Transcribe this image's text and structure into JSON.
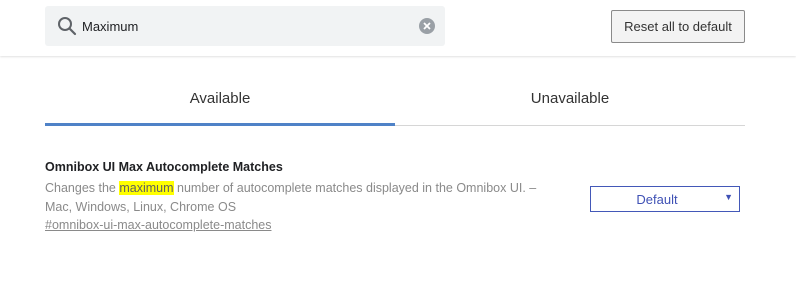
{
  "search": {
    "value": "Maximum",
    "search_icon": "search-icon",
    "clear_icon": "clear-circle-icon"
  },
  "header": {
    "reset_label": "Reset all to default"
  },
  "tabs": [
    {
      "label": "Available",
      "selected": true
    },
    {
      "label": "Unavailable",
      "selected": false
    }
  ],
  "experiment": {
    "title": "Omnibox UI Max Autocomplete Matches",
    "desc_before": "Changes the ",
    "desc_highlight": "maximum",
    "desc_after": " number of autocomplete matches displayed in the Omnibox UI. – Mac, Windows, Linux, Chrome OS",
    "link": "#omnibox-ui-max-autocomplete-matches",
    "select_value": "Default",
    "select_arrow": "▼"
  },
  "colors": {
    "accent": "#4f82c7",
    "highlight": "#ffff00",
    "select_text": "#3f51b5"
  }
}
